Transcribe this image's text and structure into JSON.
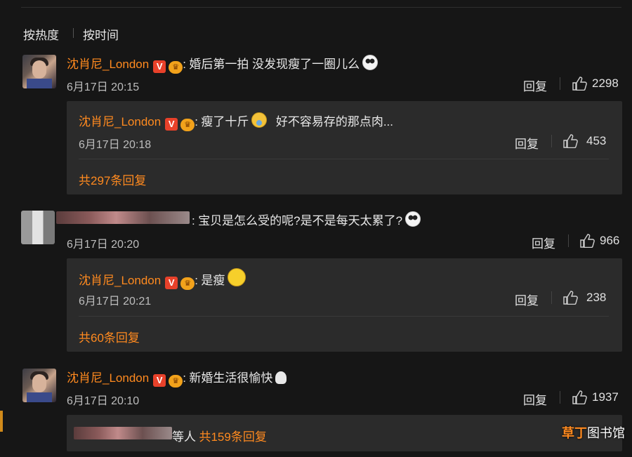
{
  "sort_tabs": {
    "hot": "按热度",
    "time": "按时间"
  },
  "comments": [
    {
      "name": "沈肖尼_London",
      "v_badge": "V",
      "crown_badge": "♛",
      "colon": ":",
      "text": "婚后第一拍 没发现瘦了一圈儿么",
      "emoji": "panda-emoji",
      "date": "6月17日 20:15",
      "reply_label": "回复",
      "likes": "2298",
      "sub_reply": {
        "name": "沈肖尼_London",
        "colon": ":",
        "text_before": "瘦了十斤",
        "emoji": "cry-laugh-emoji",
        "text_after": "好不容易存的那点肉...",
        "date": "6月17日 20:18",
        "reply_label": "回复",
        "likes": "453"
      },
      "more": "共297条回复"
    },
    {
      "name_blurred": true,
      "colon": ":",
      "text": "宝贝是怎么受的呢?是不是每天太累了?",
      "emoji": "panda-emoji",
      "date": "6月17日 20:20",
      "reply_label": "回复",
      "likes": "966",
      "sub_reply": {
        "name": "沈肖尼_London",
        "colon": ":",
        "text_before": "是瘦",
        "emoji": "smile-emoji",
        "date": "6月17日 20:21",
        "reply_label": "回复",
        "likes": "238"
      },
      "more": "共60条回复"
    },
    {
      "name": "沈肖尼_London",
      "colon": ":",
      "text": "新婚生活很愉快",
      "emoji": "ghost-emoji",
      "date": "6月17日 20:10",
      "reply_label": "回复",
      "likes": "1937",
      "others_suffix": "等人",
      "more": "共159条回复"
    }
  ],
  "watermark": {
    "part1": "草丁",
    "part2": "图书馆"
  },
  "colors": {
    "accent": "#ff8a1f",
    "background": "#161616",
    "panel": "#2b2b2b",
    "v_badge": "#e8412a"
  }
}
